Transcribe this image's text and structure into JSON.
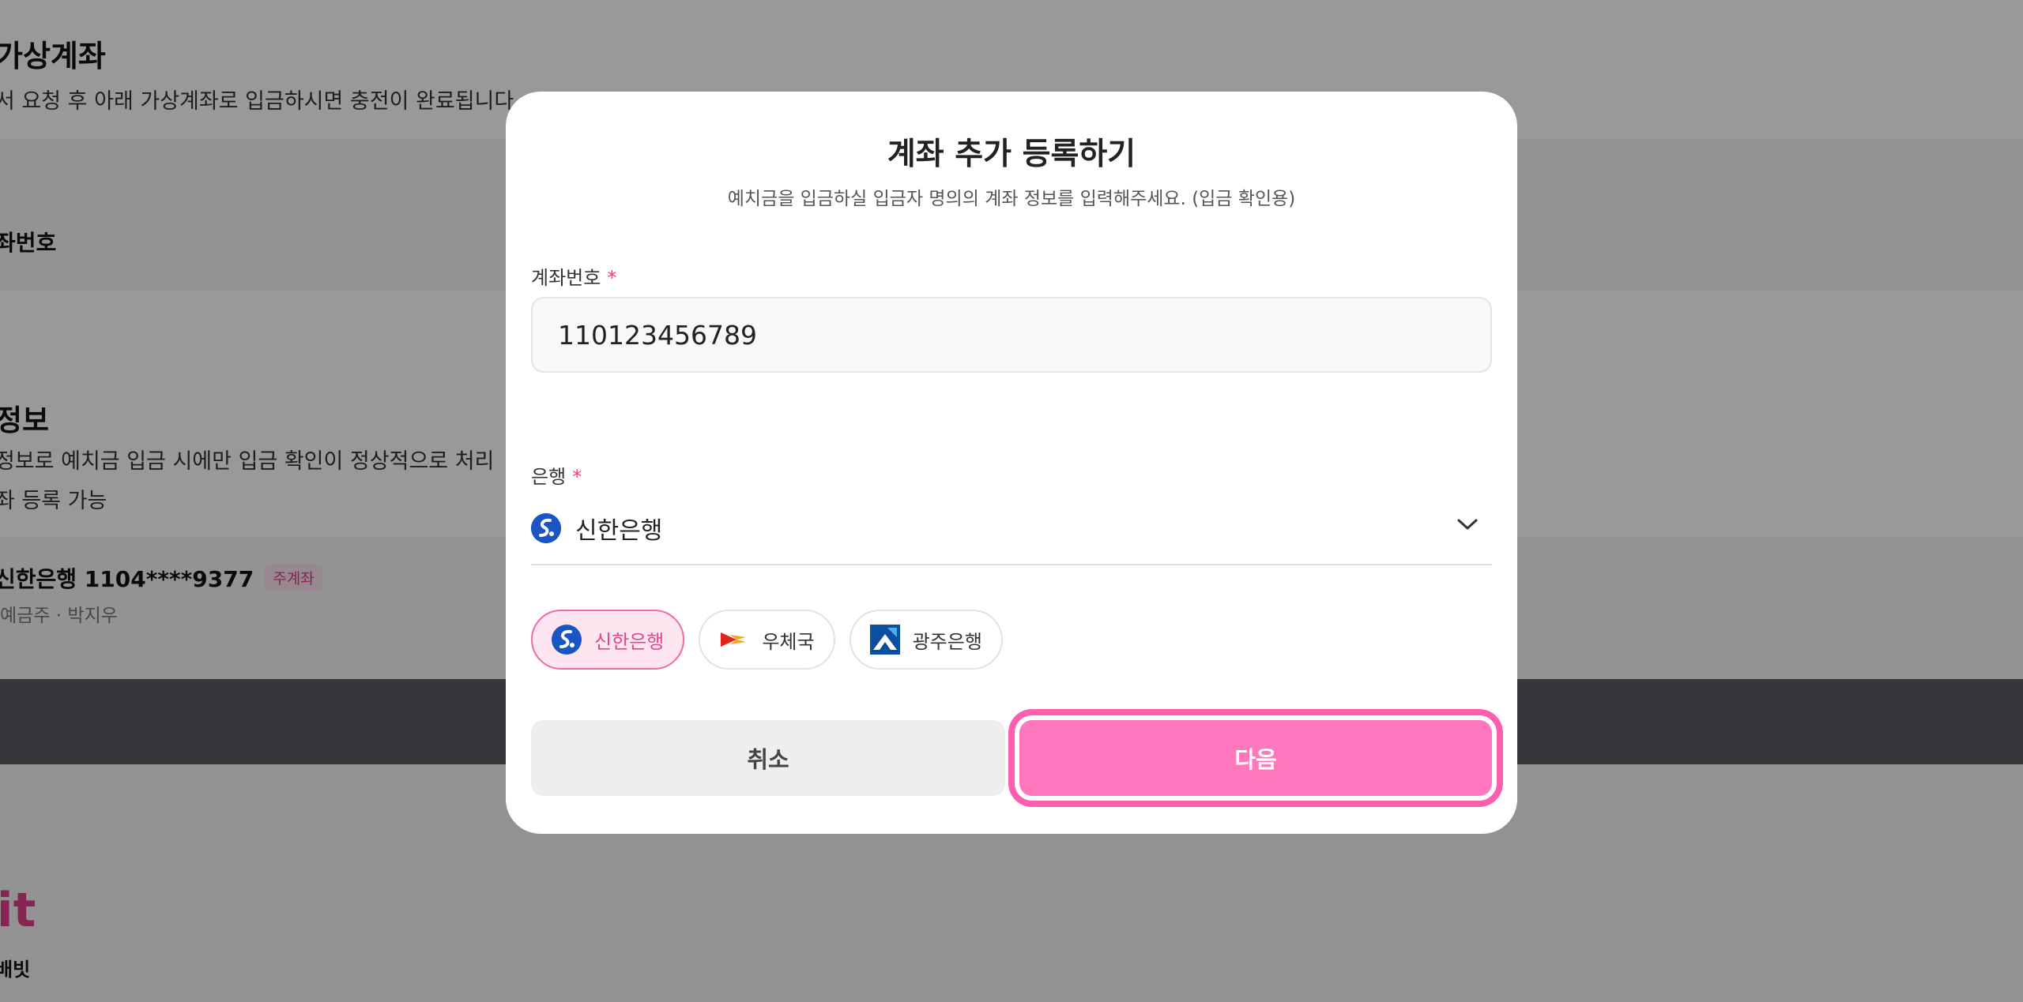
{
  "background": {
    "section1_title": "가상계좌",
    "section1_desc": "서 요청 후 아래 가상계좌로 입금하시면 충전이 완료됩니다",
    "account_number_label": "좌번호",
    "section2_title": "정보",
    "section2_desc1": "정보로 예치금 입금 시에만 입금 확인이 정상적으로 처리",
    "section2_desc2": "좌 등록 가능",
    "registered_account": "신한은행 1104****9377",
    "main_account_badge": "주계좌",
    "account_holder": "예금주 · 박지우",
    "footer_logo": "it",
    "footer_company": "배빗"
  },
  "modal": {
    "title": "계좌 추가 등록하기",
    "subtitle": "예치금을 입금하실 입금자 명의의 계좌 정보를 입력해주세요. (입금 확인용)",
    "account_field": {
      "label": "계좌번호",
      "required_mark": "*",
      "value": "110123456789"
    },
    "bank_field": {
      "label": "은행",
      "required_mark": "*",
      "selected": "신한은행",
      "icon": "chevron-down-icon"
    },
    "quick_banks": [
      {
        "label": "신한은행",
        "icon": "shinhan-logo-icon",
        "active": true
      },
      {
        "label": "우체국",
        "icon": "post-office-logo-icon",
        "active": false
      },
      {
        "label": "광주은행",
        "icon": "kwangju-bank-logo-icon",
        "active": false
      }
    ],
    "cancel_label": "취소",
    "next_label": "다음"
  },
  "colors": {
    "accent": "#ff78be",
    "accent_outline": "#ff5eaf",
    "active_chip_bg": "#fde6f0",
    "required": "#e8447a",
    "shinhan_blue": "#1a55c4"
  }
}
